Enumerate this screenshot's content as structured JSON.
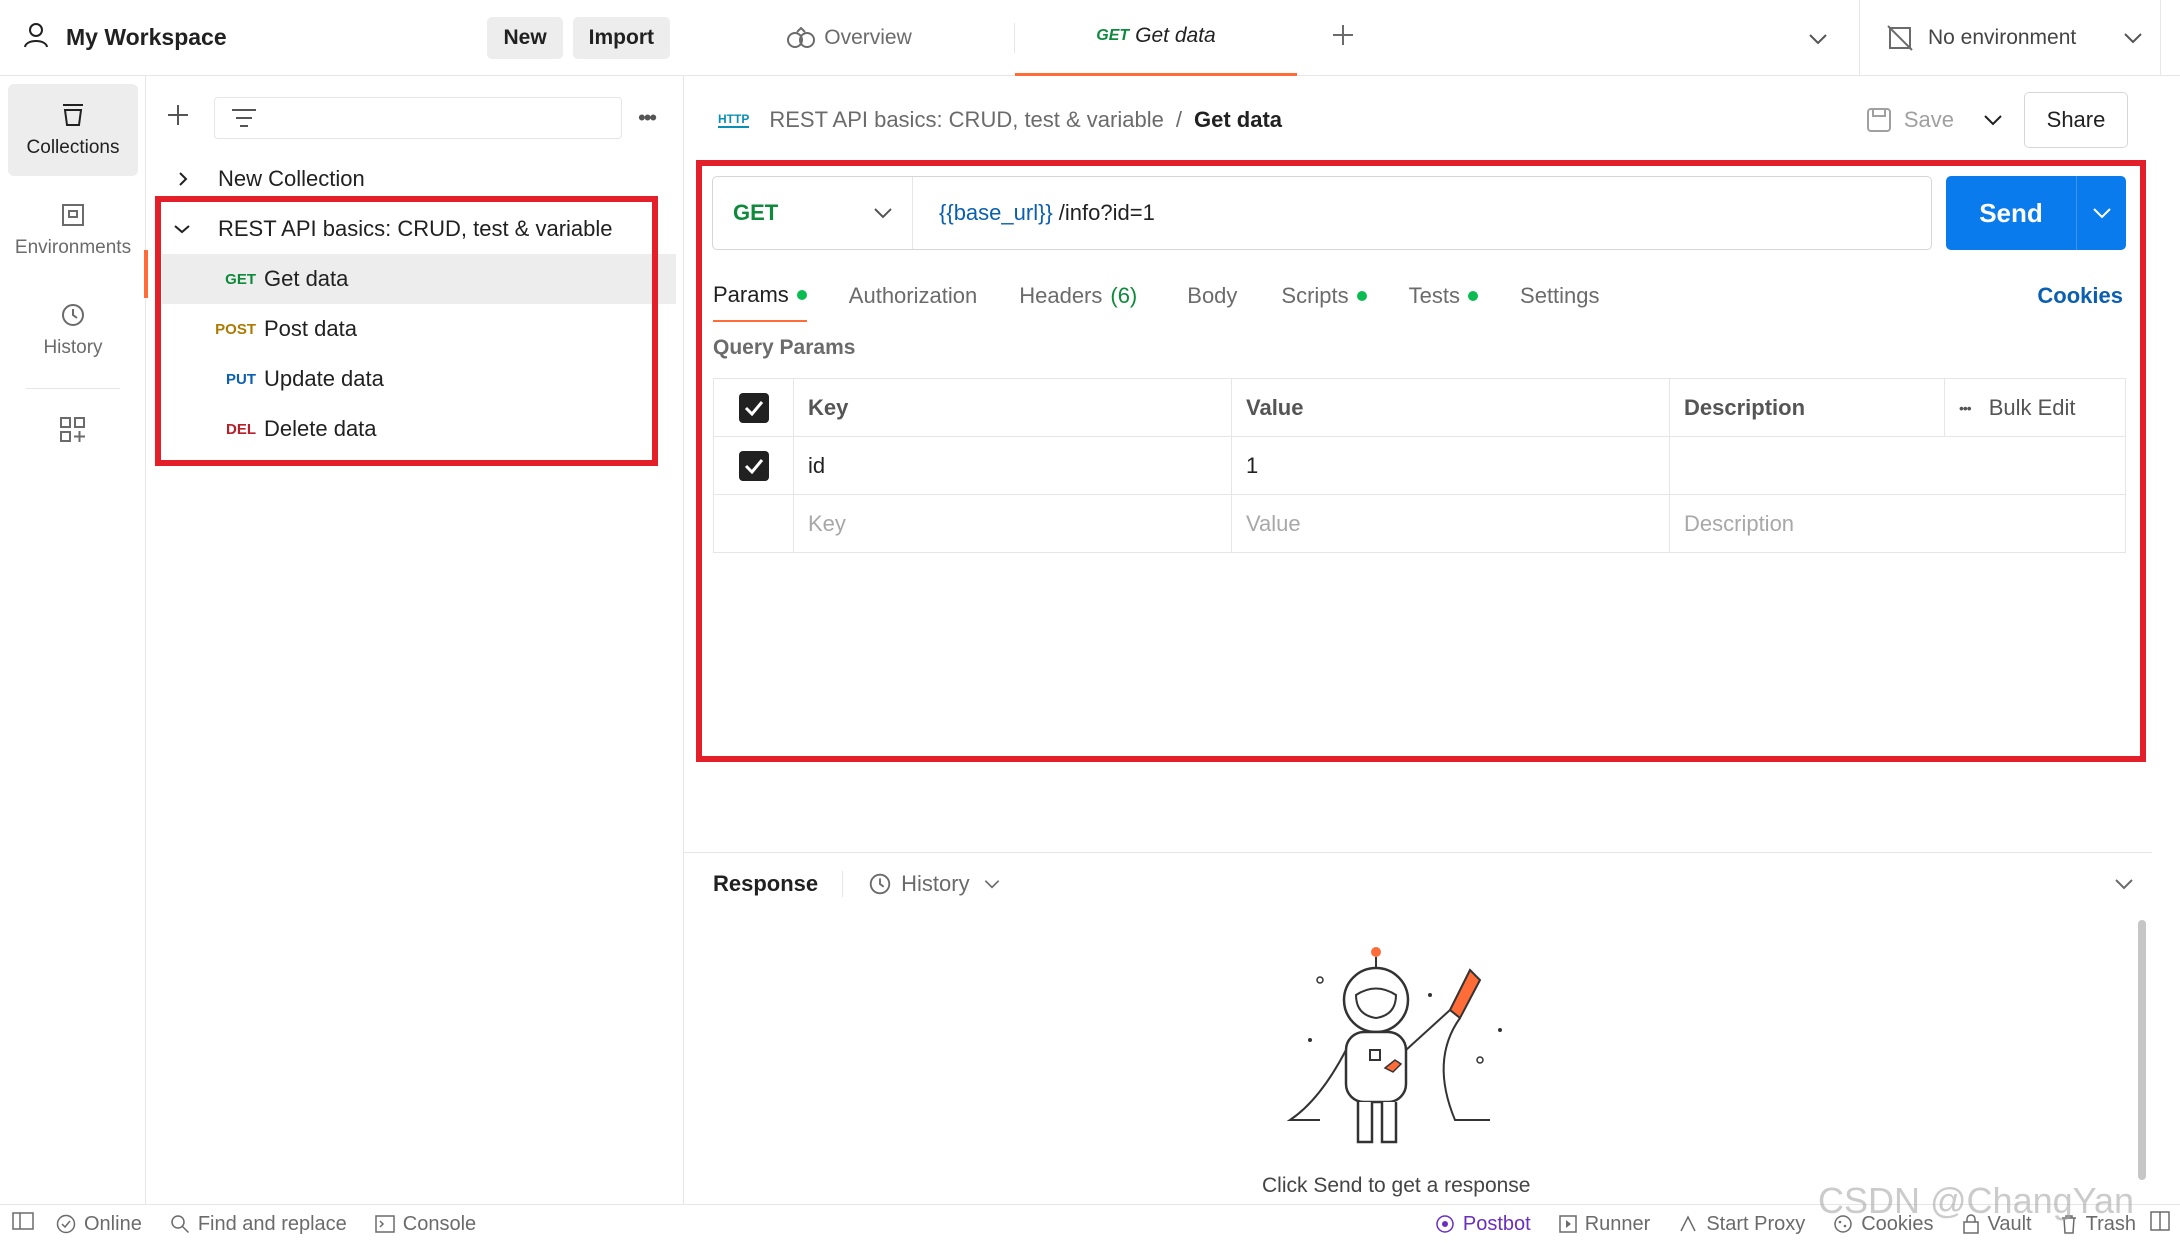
{
  "workspace": {
    "title": "My Workspace",
    "new_label": "New",
    "import_label": "Import"
  },
  "rail": [
    {
      "label": "Collections",
      "icon": "collections-icon"
    },
    {
      "label": "Environments",
      "icon": "environments-icon"
    },
    {
      "label": "History",
      "icon": "history-icon"
    }
  ],
  "sidebar": {
    "collections": [
      {
        "label": "New Collection"
      },
      {
        "label": "REST API basics: CRUD, test & variable"
      }
    ],
    "requests": [
      {
        "method": "GET",
        "label": "Get data",
        "color": "#0f8a3c"
      },
      {
        "method": "POST",
        "label": "Post data",
        "color": "#ad7a03"
      },
      {
        "method": "PUT",
        "label": "Update data",
        "color": "#0b5fb0"
      },
      {
        "method": "DEL",
        "label": "Delete data",
        "color": "#b5202a"
      }
    ]
  },
  "tabs": {
    "overview": "Overview",
    "active_method": "GET",
    "active_label": "Get data",
    "environment": "No environment"
  },
  "breadcrumb": {
    "collection": "REST API basics: CRUD, test & variable",
    "separator": "/",
    "request": "Get data",
    "http_badge": "HTTP"
  },
  "toolbar": {
    "save": "Save",
    "share": "Share"
  },
  "request": {
    "method": "GET",
    "url_var": "{{base_url}}",
    "url_path": "/info?id=1",
    "send": "Send"
  },
  "request_tabs": {
    "params": "Params",
    "authorization": "Authorization",
    "headers": "Headers",
    "headers_count": "(6)",
    "body": "Body",
    "scripts": "Scripts",
    "tests": "Tests",
    "settings": "Settings",
    "cookies": "Cookies"
  },
  "query_params": {
    "title": "Query Params",
    "headers": {
      "key": "Key",
      "value": "Value",
      "description": "Description",
      "bulk_edit": "Bulk Edit"
    },
    "rows": [
      {
        "key": "id",
        "value": "1",
        "description": ""
      }
    ],
    "placeholder": {
      "key": "Key",
      "value": "Value",
      "description": "Description"
    }
  },
  "response": {
    "title": "Response",
    "history": "History",
    "empty_text": "Click Send to get a response"
  },
  "status_bar": {
    "online": "Online",
    "find_replace": "Find and replace",
    "console": "Console",
    "postbot": "Postbot",
    "runner": "Runner",
    "start_proxy": "Start Proxy",
    "cookies": "Cookies",
    "vault": "Vault",
    "trash": "Trash"
  },
  "watermark": "CSDN @ChangYan",
  "colors": {
    "accent": "#ff6c37",
    "send": "#097bed",
    "highlight": "#e3202a",
    "get": "#0f8a3c",
    "link": "#0b5fb0"
  }
}
